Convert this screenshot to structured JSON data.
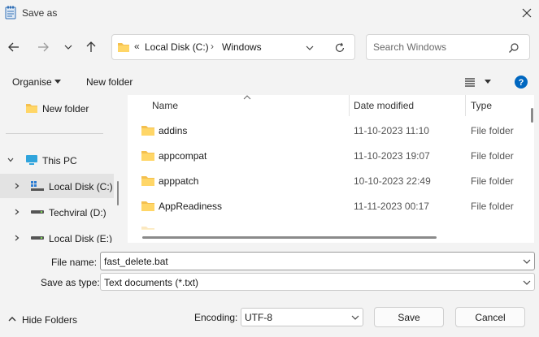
{
  "title": "Save as",
  "address": {
    "prefix": "«",
    "segments": [
      "Local Disk (C:)",
      "Windows"
    ],
    "separator": "›"
  },
  "search": {
    "placeholder": "Search Windows"
  },
  "toolbar": {
    "organise": "Organise",
    "new_folder": "New folder"
  },
  "sidebar": {
    "items": [
      {
        "label": "New folder",
        "icon": "folder-icon"
      },
      {
        "label": "This PC",
        "icon": "monitor-icon"
      },
      {
        "label": "Local Disk (C:)",
        "icon": "windows-drive-icon",
        "selected": true
      },
      {
        "label": "Techviral (D:)",
        "icon": "drive-icon"
      },
      {
        "label": "Local Disk (E:)",
        "icon": "drive-icon"
      }
    ]
  },
  "columns": {
    "name": "Name",
    "date": "Date modified",
    "type": "Type"
  },
  "files": [
    {
      "name": "addins",
      "date": "11-10-2023 11:10",
      "type": "File folder"
    },
    {
      "name": "appcompat",
      "date": "11-10-2023 19:07",
      "type": "File folder"
    },
    {
      "name": "apppatch",
      "date": "10-10-2023 22:49",
      "type": "File folder"
    },
    {
      "name": "AppReadiness",
      "date": "11-11-2023 00:17",
      "type": "File folder"
    }
  ],
  "form": {
    "file_name_label": "File name:",
    "file_name": "fast_delete.bat",
    "save_type_label": "Save as type:",
    "save_type": "Text documents (*.txt)"
  },
  "footer": {
    "hide_folders": "Hide Folders",
    "encoding_label": "Encoding:",
    "encoding": "UTF-8",
    "save": "Save",
    "cancel": "Cancel"
  },
  "colors": {
    "accent": "#0067c0",
    "folder": "#f4c04f",
    "selection": "#e3e3e3"
  }
}
